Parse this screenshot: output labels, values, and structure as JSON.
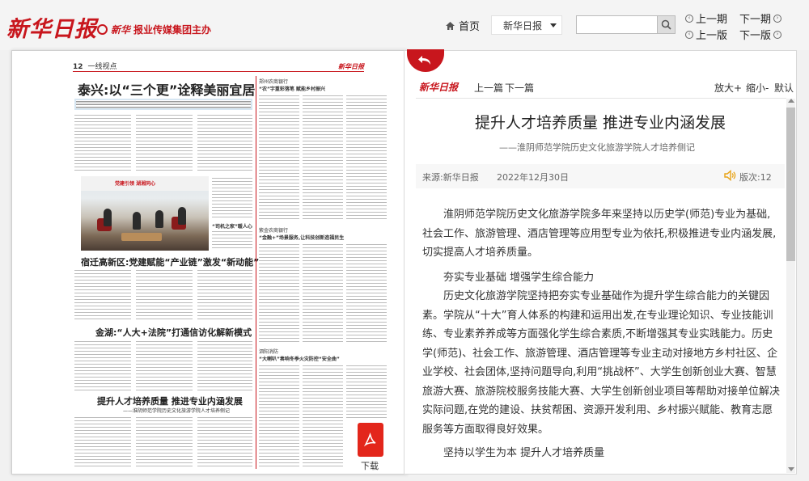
{
  "header": {
    "logo_text": "新华日报",
    "group_brand": "新华",
    "group_text": "报业传媒集团主办",
    "home_label": "首页",
    "paper_select": "新华日报",
    "search": {
      "value": "",
      "placeholder": ""
    },
    "nav": {
      "prev_issue": "上一期",
      "next_issue": "下一期",
      "prev_page": "上一版",
      "next_page": "下一版"
    }
  },
  "newspaper_page": {
    "page_number": "12",
    "section": "一线视点",
    "brand_mini": "新华日报",
    "main_headline": "泰兴:以“三个更”诠释美丽宜居",
    "top_right_kicker": "郑州农商银行",
    "top_right_heading": "“农”字重彩落笔 赋能乡村振兴",
    "photo_sign": "党建引领 湖湘同心",
    "inset_title": "“司机之家”暖人心",
    "mid_right_kicker": "紫金农商银行",
    "mid_right_heading": "“金融+”场景服务,让科技创新造福民生",
    "story2_heading": "宿迁高新区:党建赋能“产业链”激发“新动能”",
    "story3_heading": "金湖:“人大+法院”打通信访化解新模式",
    "bottom_right_kicker": "泗阳消防",
    "bottom_right_heading": "“大喇叭”奏响冬季火灾防控“安全曲”",
    "story4_heading": "提升人才培养质量 推进专业内涵发展",
    "story4_sub": "——淮阴师范学院历史文化旅游学院人才培养侧记"
  },
  "download": {
    "label": "下载"
  },
  "article": {
    "toolbar": {
      "logo_text": "新华日报",
      "prev": "上一篇",
      "next": "下一篇",
      "zoom_in": "放大+",
      "zoom_out": "缩小-",
      "default": "默认"
    },
    "title": "提升人才培养质量 推进专业内涵发展",
    "subtitle": "——淮阴师范学院历史文化旅游学院人才培养侧记",
    "source": "来源:新华日报",
    "date": "2022年12月30日",
    "edition": "版次:12",
    "paragraphs": [
      "淮阴师范学院历史文化旅游学院多年来坚持以历史学(师范)专业为基础,社会工作、旅游管理、酒店管理等应用型专业为依托,积极推进专业内涵发展,切实提高人才培养质量。",
      "夯实专业基础 增强学生综合能力",
      "历史文化旅游学院坚持把夯实专业基础作为提升学生综合能力的关键因素。学院从“十大”育人体系的构建和运用出发,在专业理论知识、专业技能训练、专业素养养成等方面强化学生综合素质,不断增强其专业实践能力。历史学(师范)、社会工作、旅游管理、酒店管理等专业主动对接地方乡村社区、企业学校、社会团体,坚持问题导向,利用“挑战杯”、大学生创新创业大赛、智慧旅游大赛、旅游院校服务技能大赛、大学生创新创业项目等帮助对接单位解决实际问题,在党的建设、扶贫帮困、资源开发利用、乡村振兴赋能、教育志愿服务等方面取得良好效果。",
      "坚持以学生为本 提升人才培养质量"
    ]
  }
}
